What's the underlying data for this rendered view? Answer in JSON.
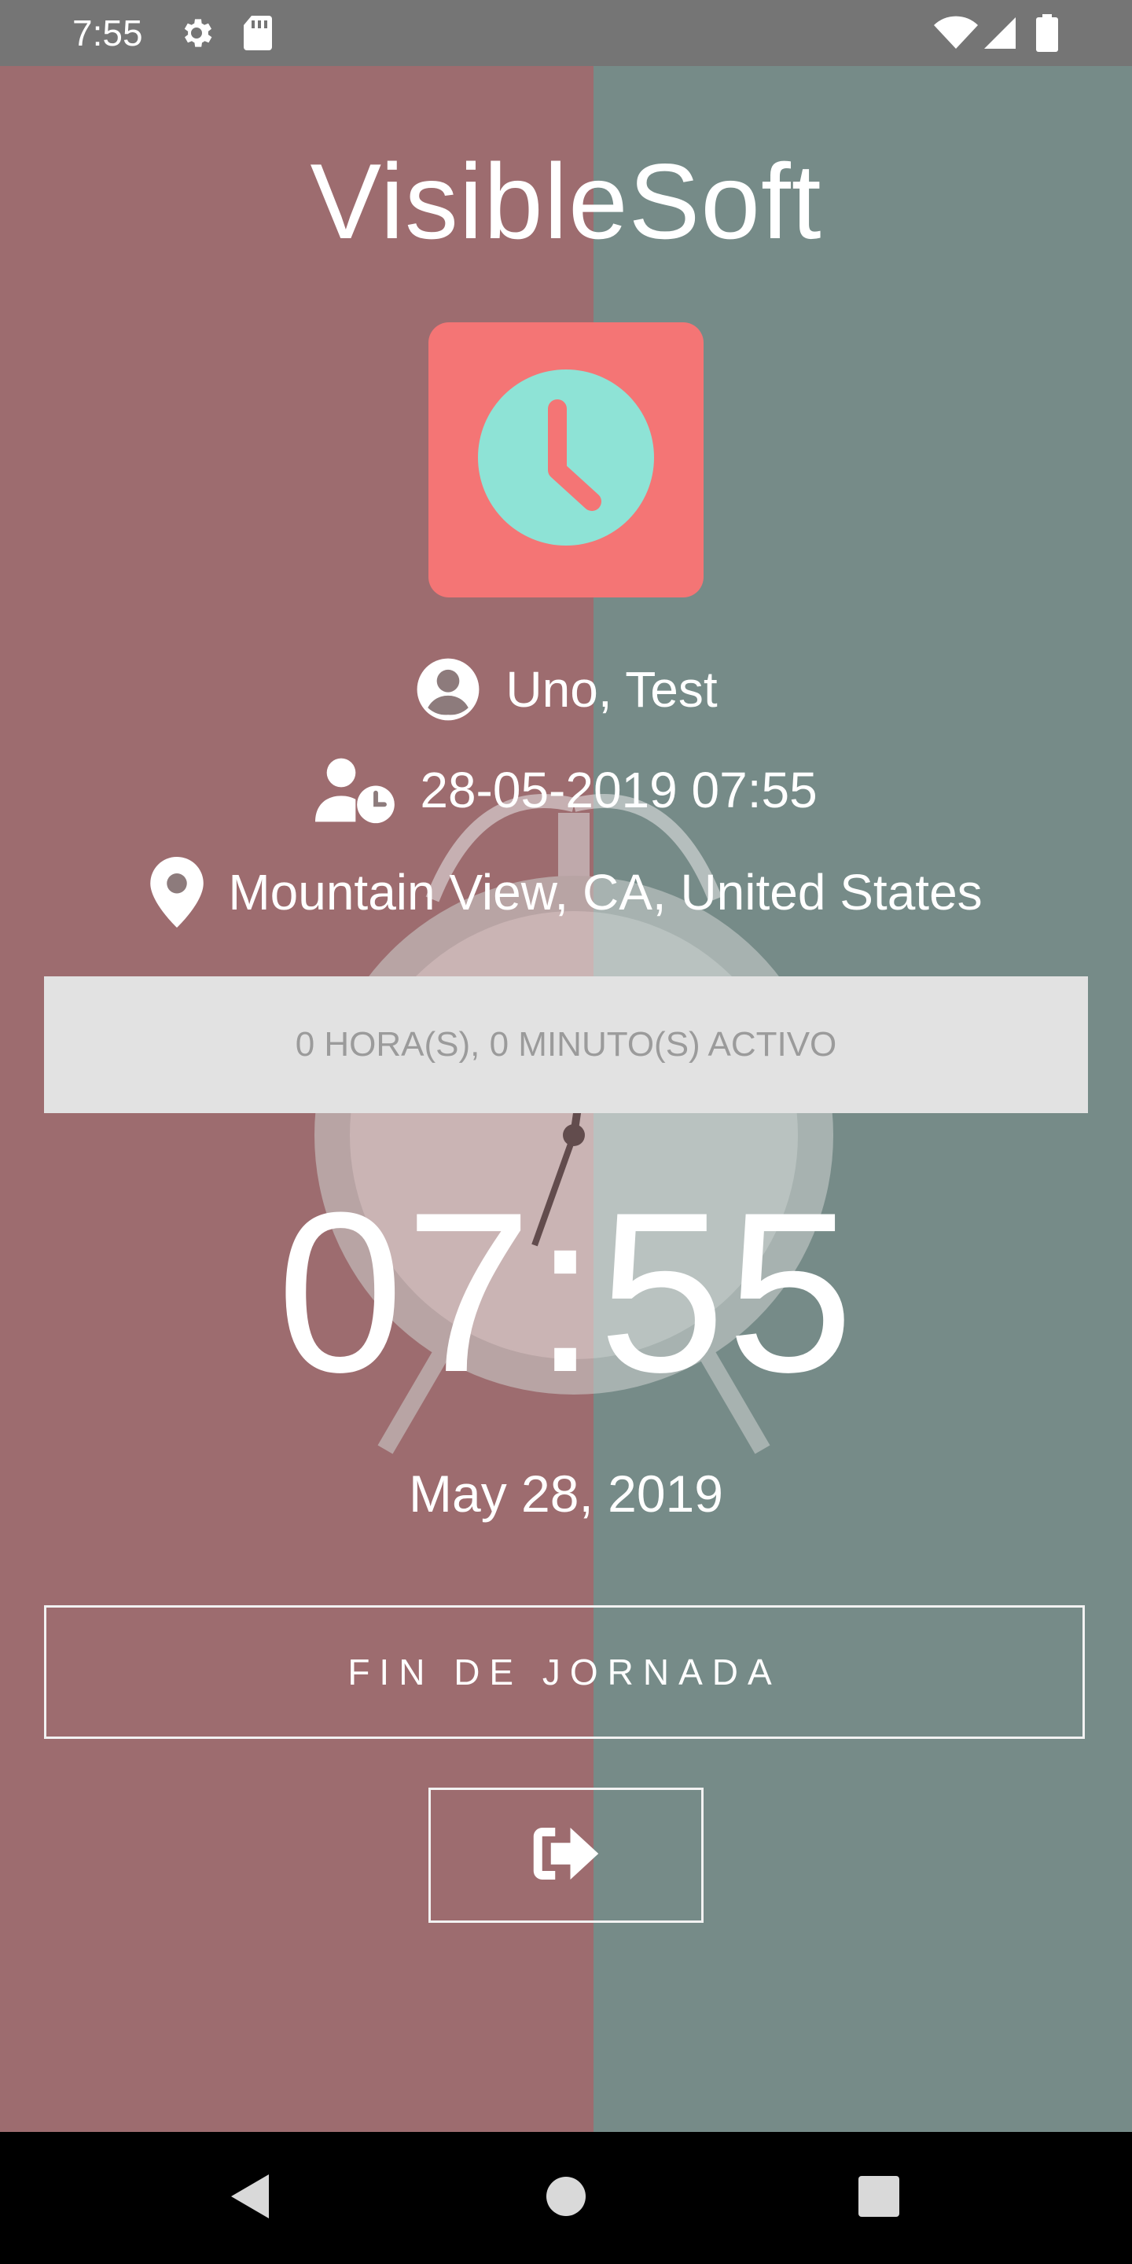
{
  "status_bar": {
    "time": "7:55",
    "icons": [
      "gear-icon",
      "sd-card-icon",
      "wifi-icon",
      "signal-icon",
      "battery-icon"
    ]
  },
  "app": {
    "title": "VisibleSoft",
    "logo_icon": "clock-icon",
    "user": {
      "icon": "user-circle-icon",
      "name": "Uno, Test"
    },
    "check_in": {
      "icon": "user-clock-icon",
      "datetime": "28-05-2019 07:55"
    },
    "location": {
      "icon": "map-pin-icon",
      "text": "Mountain View, CA, United States"
    },
    "active_time": "0 HORA(S), 0 MINUTO(S) ACTIVO",
    "clock": "07:55",
    "date": "May 28, 2019",
    "end_day_label": "FIN DE JORNADA",
    "logout_icon": "sign-out-icon"
  },
  "nav_bar": {
    "buttons": [
      "back-icon",
      "home-icon",
      "recents-icon"
    ]
  },
  "colors": {
    "status_bar": "#757575",
    "bg_left": "#9d6c6f",
    "bg_right": "#768b88",
    "logo_bg": "#f47575",
    "logo_clock": "#8ee3d6",
    "active_box": "#e2e2e2",
    "active_text": "#9b9b9b"
  }
}
